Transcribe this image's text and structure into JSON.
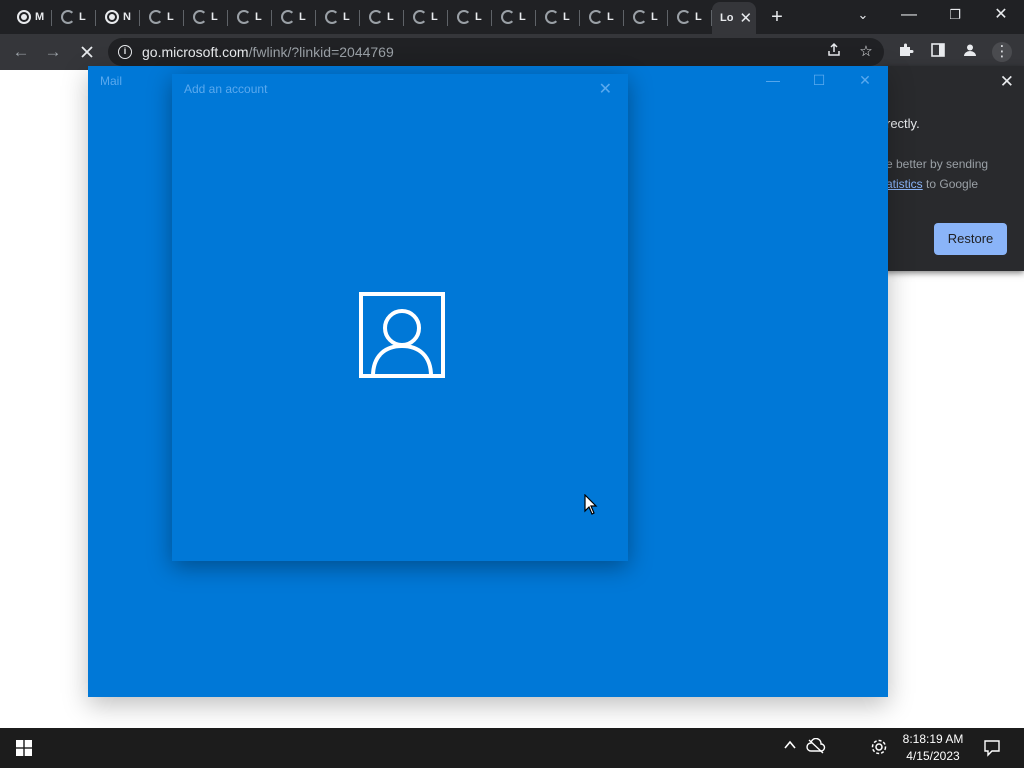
{
  "browser": {
    "tabs": [
      {
        "label": "M",
        "favicon": "target-icon"
      },
      {
        "label": "L",
        "favicon": "loading-spinner-icon"
      },
      {
        "label": "N",
        "favicon": "target-icon"
      },
      {
        "label": "L",
        "favicon": "loading-spinner-icon"
      },
      {
        "label": "L",
        "favicon": "loading-spinner-icon"
      },
      {
        "label": "L",
        "favicon": "loading-spinner-icon"
      },
      {
        "label": "L",
        "favicon": "loading-spinner-icon"
      },
      {
        "label": "L",
        "favicon": "loading-spinner-icon"
      },
      {
        "label": "L",
        "favicon": "loading-spinner-icon"
      },
      {
        "label": "L",
        "favicon": "loading-spinner-icon"
      },
      {
        "label": "L",
        "favicon": "loading-spinner-icon"
      },
      {
        "label": "L",
        "favicon": "loading-spinner-icon"
      },
      {
        "label": "L",
        "favicon": "loading-spinner-icon"
      },
      {
        "label": "L",
        "favicon": "loading-spinner-icon"
      },
      {
        "label": "L",
        "favicon": "loading-spinner-icon"
      },
      {
        "label": "L",
        "favicon": "loading-spinner-icon"
      },
      {
        "label": "Lo",
        "favicon": "none",
        "active": true
      }
    ],
    "new_tab_glyph": "+",
    "window_controls": {
      "dropdown": "⌄",
      "minimize": "—",
      "restore": "❐",
      "close": "✕"
    },
    "url_host": "go.microsoft.com",
    "url_rest": "/fwlink/?linkid=2044769"
  },
  "restore_popup": {
    "line1": "rectly.",
    "line2": "e better by sending",
    "line3_link": "atistics",
    "line3_rest": " to Google",
    "button_label": "Restore",
    "close_glyph": "✕"
  },
  "mail_window": {
    "title": "Mail",
    "controls": {
      "minimize": "—",
      "maximize": "☐",
      "close": "✕"
    },
    "background": "#0078d7"
  },
  "add_account_dialog": {
    "title": "Add an account",
    "close_glyph": "✕",
    "icon": "person-placeholder-icon"
  },
  "taskbar": {
    "time": "8:18:19 AM",
    "date": "4/15/2023",
    "tray_icons": [
      "chevron-up-icon",
      "cloud-offline-icon",
      "settings-gear-icon",
      "notification-icon"
    ]
  },
  "colors": {
    "chrome_dark": "#202124",
    "chrome_toolbar": "#35363a",
    "accent_blue": "#8ab4f8",
    "windows_blue": "#0078d7",
    "taskbar": "#1c1c1c"
  }
}
